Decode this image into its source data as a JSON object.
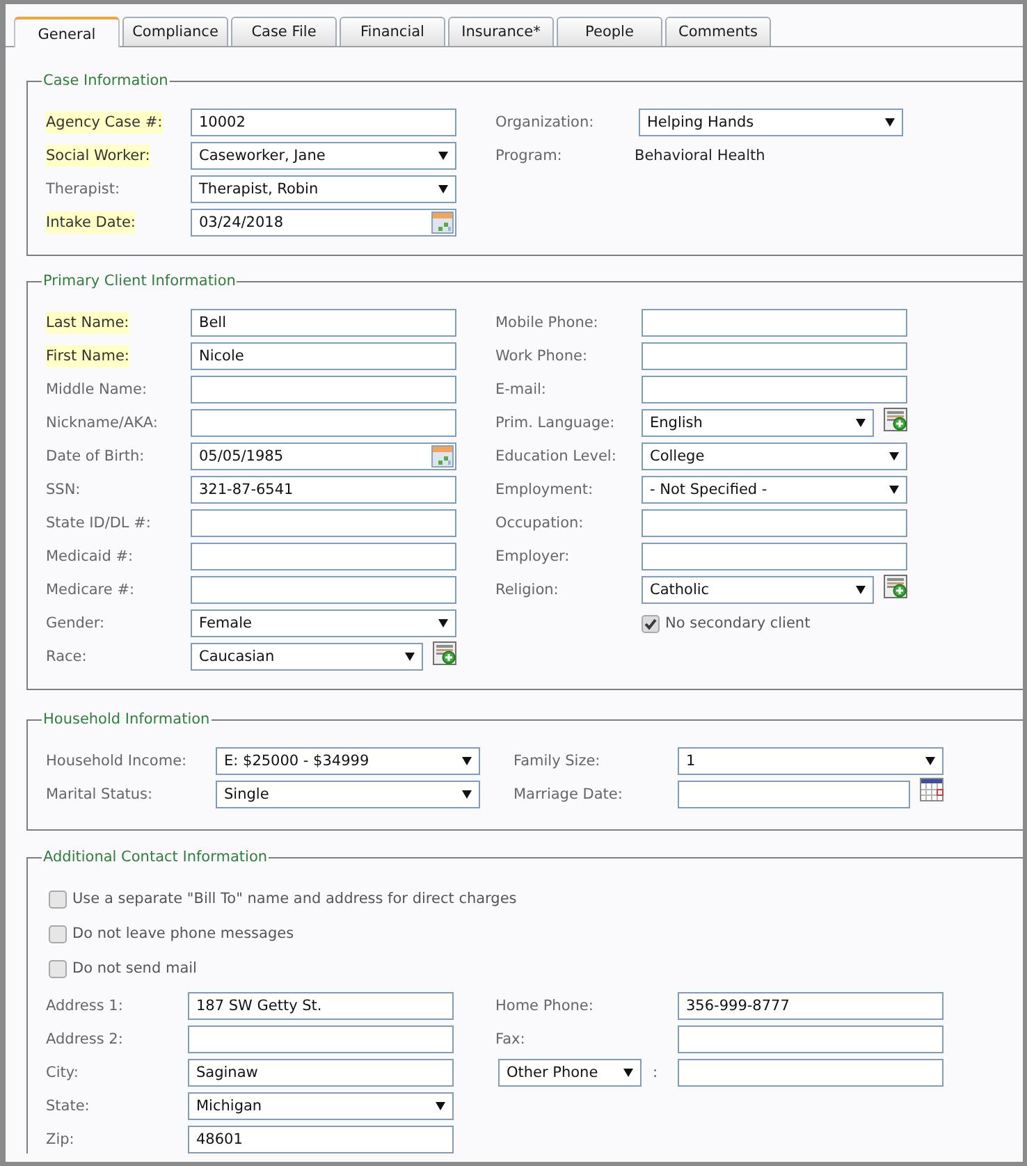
{
  "tabs": [
    {
      "label": "General",
      "selected": true
    },
    {
      "label": "Compliance",
      "selected": false
    },
    {
      "label": "Case File",
      "selected": false
    },
    {
      "label": "Financial",
      "selected": false
    },
    {
      "label": "Insurance*",
      "selected": false
    },
    {
      "label": "People",
      "selected": false
    },
    {
      "label": "Comments",
      "selected": false
    }
  ],
  "sections": [
    {
      "title": "Case Information",
      "left": [
        {
          "label": "Agency Case #:",
          "required": true,
          "kind": "text",
          "value": "10002"
        },
        {
          "label": "Social Worker:",
          "required": true,
          "kind": "select",
          "value": "Caseworker, Jane"
        },
        {
          "label": "Therapist:",
          "required": false,
          "kind": "select",
          "value": "Therapist, Robin"
        },
        {
          "label": "Intake Date:",
          "required": true,
          "kind": "date",
          "value": "03/24/2018"
        }
      ],
      "right": [
        {
          "label": "Organization:",
          "required": false,
          "kind": "select",
          "value": "Helping Hands"
        },
        {
          "label": "Program:",
          "required": false,
          "kind": "static",
          "value": "Behavioral Health"
        }
      ]
    },
    {
      "title": "Primary Client Information",
      "left": [
        {
          "label": "Last Name:",
          "required": true,
          "kind": "text",
          "value": "Bell"
        },
        {
          "label": "First Name:",
          "required": true,
          "kind": "text",
          "value": "Nicole"
        },
        {
          "label": "Middle Name:",
          "required": false,
          "kind": "text"
        },
        {
          "label": "Nickname/AKA:",
          "required": false,
          "kind": "text"
        },
        {
          "label": "Date of Birth:",
          "required": false,
          "kind": "date",
          "value": "05/05/1985"
        },
        {
          "label": "SSN:",
          "required": false,
          "kind": "text",
          "value": "321-87-6541"
        },
        {
          "label": "State ID/DL #:",
          "required": false,
          "kind": "text"
        },
        {
          "label": "Medicaid #:",
          "required": false,
          "kind": "text"
        },
        {
          "label": "Medicare #:",
          "required": false,
          "kind": "text"
        },
        {
          "label": "Gender:",
          "required": false,
          "kind": "select",
          "value": "Female"
        },
        {
          "label": "Race:",
          "required": false,
          "kind": "select-add",
          "value": "Caucasian"
        }
      ],
      "right": [
        {
          "label": "Mobile Phone:",
          "required": false,
          "kind": "text"
        },
        {
          "label": "Work Phone:",
          "required": false,
          "kind": "text"
        },
        {
          "label": "E-mail:",
          "required": false,
          "kind": "text"
        },
        {
          "label": "Prim. Language:",
          "required": false,
          "kind": "select-add",
          "value": "English"
        },
        {
          "label": "Education Level:",
          "required": false,
          "kind": "select",
          "value": "College"
        },
        {
          "label": "Employment:",
          "required": false,
          "kind": "select",
          "value": "- Not Specified -"
        },
        {
          "label": "Occupation:",
          "required": false,
          "kind": "text"
        },
        {
          "label": "Employer:",
          "required": false,
          "kind": "text"
        },
        {
          "label": "Religion:",
          "required": false,
          "kind": "select-add",
          "value": "Catholic"
        },
        {
          "kind": "checkbox",
          "label": "No secondary client",
          "checked": true
        }
      ]
    },
    {
      "title": "Household Information",
      "left": [
        {
          "label": "Household Income:",
          "required": false,
          "kind": "select",
          "value": "E: $25000 - $34999"
        },
        {
          "label": "Marital Status:",
          "required": false,
          "kind": "select",
          "value": "Single"
        }
      ],
      "right": [
        {
          "label": "Family Size:",
          "required": false,
          "kind": "select",
          "value": "1"
        },
        {
          "label": "Marriage Date:",
          "required": false,
          "kind": "date-button"
        }
      ]
    },
    {
      "title": "Additional Contact Information",
      "options": [
        {
          "label": "Use a separate \"Bill To\" name and address for direct charges",
          "checked": false
        },
        {
          "label": "Do not leave phone messages",
          "checked": false
        },
        {
          "label": "Do not send mail",
          "checked": false
        }
      ],
      "left": [
        {
          "label": "Address 1:",
          "required": false,
          "kind": "text",
          "value": "187 SW Getty St."
        },
        {
          "label": "Address 2:",
          "required": false,
          "kind": "text"
        },
        {
          "label": "City:",
          "required": false,
          "kind": "text",
          "value": "Saginaw"
        },
        {
          "label": "State:",
          "required": false,
          "kind": "select",
          "value": "Michigan"
        },
        {
          "label": "Zip:",
          "required": false,
          "kind": "text",
          "value": "48601"
        }
      ],
      "right": [
        {
          "label": "Home Phone:",
          "required": false,
          "kind": "text",
          "value": "356-999-8777"
        },
        {
          "label": "Fax:",
          "required": false,
          "kind": "text"
        },
        {
          "kind": "phone-type",
          "selector": "Other Phone",
          "separator": ":"
        }
      ]
    }
  ]
}
